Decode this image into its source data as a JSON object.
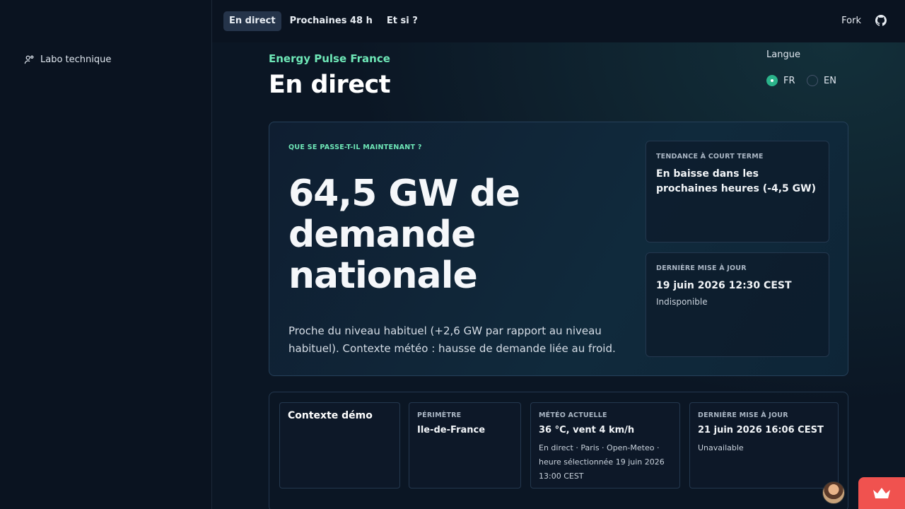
{
  "sidebar": {
    "items": [
      {
        "label": "Labo technique",
        "icon": "user-gear-icon"
      }
    ]
  },
  "nav": {
    "tabs": [
      {
        "label": "En direct",
        "active": true
      },
      {
        "label": "Prochaines 48 h",
        "active": false
      },
      {
        "label": "Et si ?",
        "active": false
      }
    ],
    "fork_label": "Fork",
    "github_icon": "github-icon"
  },
  "header": {
    "brand": "Energy Pulse France",
    "title": "En direct"
  },
  "language": {
    "label": "Langue",
    "options": [
      {
        "label": "FR",
        "selected": true
      },
      {
        "label": "EN",
        "selected": false
      }
    ]
  },
  "hero": {
    "eyebrow": "QUE SE PASSE-T-IL MAINTENANT ?",
    "value": "64,5 GW de demande nationale",
    "description": "Proche du niveau habituel (+2,6 GW par rapport au niveau habituel). Contexte météo : hausse de demande liée au froid.",
    "trend": {
      "label": "TENDANCE À COURT TERME",
      "value": "En baisse dans les prochaines heures (-4,5 GW)"
    },
    "update": {
      "label": "DERNIÈRE MISE À JOUR",
      "value": "19 juin 2026 12:30 CEST",
      "status": "Indisponible"
    }
  },
  "context": {
    "title": "Contexte démo",
    "perimeter": {
      "label": "PÉRIMÈTRE",
      "value": "Ile-de-France"
    },
    "weather": {
      "label": "MÉTÉO ACTUELLE",
      "value": "36 °C, vent 4 km/h",
      "detail": "En direct · Paris · Open-Meteo · heure sélectionnée 19 juin 2026 13:00 CEST"
    },
    "update": {
      "label": "DERNIÈRE MISE À JOUR",
      "value": "21 juin 2026 16:06 CEST",
      "status": "Unavailable"
    }
  },
  "colors": {
    "accent": "#6ee7b7",
    "radio": "#2bb38a",
    "floating_button": "#f0524f"
  }
}
